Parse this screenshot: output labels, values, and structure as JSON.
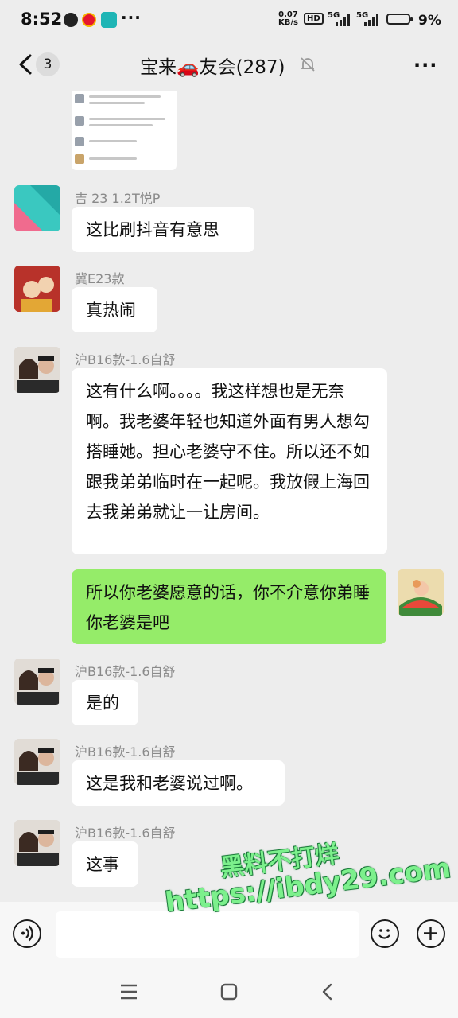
{
  "status_bar": {
    "time": "8:52",
    "net_speed_value": "0.07",
    "net_speed_unit": "KB/s",
    "hd_label": "HD",
    "signal1": "5G",
    "signal2": "5G",
    "battery_percent": "9%",
    "more_dots": "···"
  },
  "header": {
    "unread_count": "3",
    "title": "宝来🚗友会(287)",
    "more_label": "···"
  },
  "messages": [
    {
      "sender": "吉 23  1.2T悦P",
      "text": "这比刷抖音有意思"
    },
    {
      "sender": "冀E23款",
      "text": "真热闹"
    },
    {
      "sender": "沪B16款-1.6自舒",
      "text": "这有什么啊。。。。我这样想也是无奈啊。我老婆年轻也知道外面有男人想勾搭睡她。担心老婆守不住。所以还不如跟我弟弟临时在一起呢。我放假上海回去我弟弟就让一让房间。"
    },
    {
      "sender": "",
      "text": "所以你老婆愿意的话，你不介意你弟睡你老婆是吧"
    },
    {
      "sender": "沪B16款-1.6自舒",
      "text": "是的"
    },
    {
      "sender": "沪B16款-1.6自舒",
      "text": "这是我和老婆说过啊。"
    },
    {
      "sender": "沪B16款-1.6自舒",
      "text": "这事"
    }
  ],
  "watermark": {
    "line1": "黑料不打烊",
    "line2": "https://ibdy29.com"
  },
  "colors": {
    "background": "#ededed",
    "my_bubble": "#95ec69",
    "other_bubble": "#ffffff"
  }
}
